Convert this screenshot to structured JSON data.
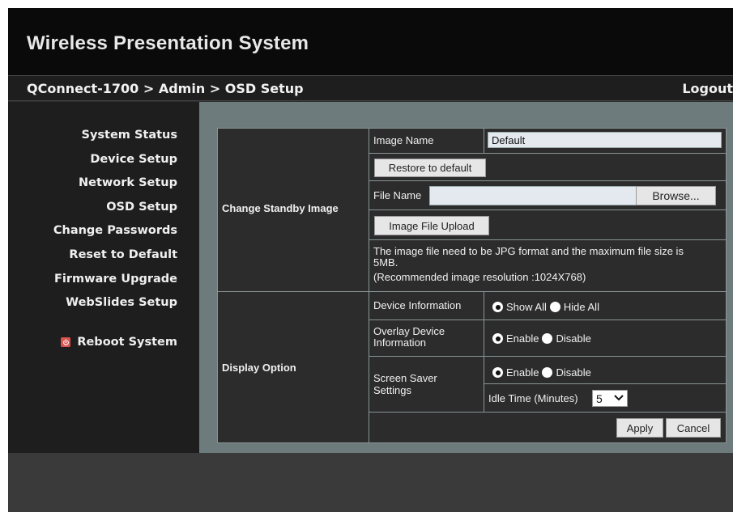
{
  "app": {
    "title": "Wireless Presentation System"
  },
  "topbar": {
    "breadcrumb": "QConnect-1700 > Admin > OSD Setup",
    "logout": "Logout"
  },
  "sidebar": {
    "items": [
      {
        "label": "System Status"
      },
      {
        "label": "Device Setup"
      },
      {
        "label": "Network Setup"
      },
      {
        "label": "OSD Setup"
      },
      {
        "label": "Change Passwords"
      },
      {
        "label": "Reset to Default"
      },
      {
        "label": "Firmware Upgrade"
      },
      {
        "label": "WebSlides Setup"
      }
    ],
    "reboot": {
      "label": "Reboot System",
      "icon": "power-icon",
      "icon_color": "#d9534f"
    }
  },
  "standby": {
    "section_label": "Change Standby Image",
    "image_name_label": "Image Name",
    "image_name_value": "Default",
    "restore_button": "Restore to default",
    "file_name_label": "File Name",
    "file_name_value": "",
    "browse_button": "Browse...",
    "upload_button": "Image File Upload",
    "note_line1": "The image file need to be JPG format and the maximum file size is",
    "note_line2": "5MB.",
    "note_line3": "(Recommended image resolution :1024X768)"
  },
  "display": {
    "section_label": "Display Option",
    "device_info_label": "Device Information",
    "show_all": "Show All",
    "hide_all": "Hide All",
    "overlay_label_line1": "Overlay Device",
    "overlay_label_line2": "Information",
    "enable": "Enable",
    "disable": "Disable",
    "screensaver_label_line1": "Screen Saver",
    "screensaver_label_line2": "Settings",
    "idle_time_label": "Idle Time (Minutes)",
    "idle_time_value": "5",
    "apply_button": "Apply",
    "cancel_button": "Cancel"
  },
  "colors": {
    "accent": "#d9534f",
    "content_bg": "#6e7b7c",
    "panel_bg": "#2c2c2c"
  }
}
